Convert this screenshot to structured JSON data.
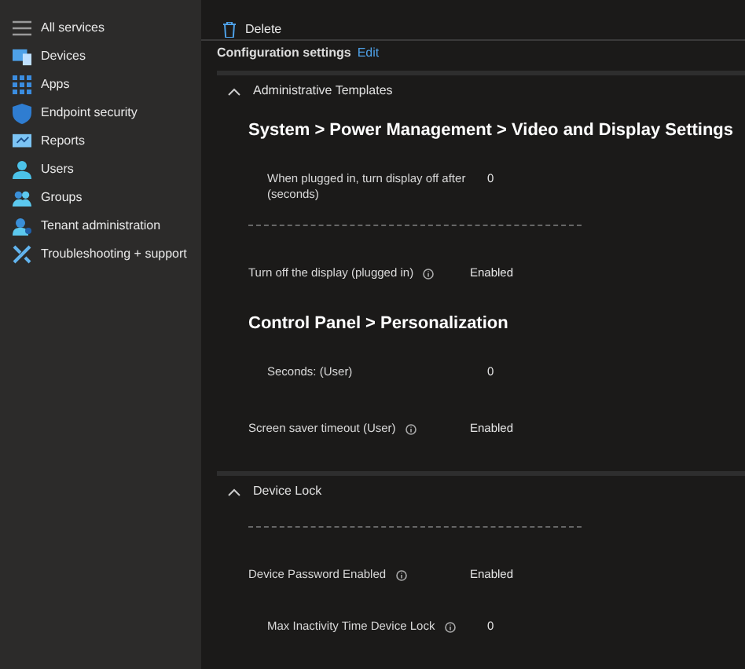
{
  "sidebar": {
    "items": [
      {
        "label": "All services"
      },
      {
        "label": "Devices"
      },
      {
        "label": "Apps"
      },
      {
        "label": "Endpoint security"
      },
      {
        "label": "Reports"
      },
      {
        "label": "Users"
      },
      {
        "label": "Groups"
      },
      {
        "label": "Tenant administration"
      },
      {
        "label": "Troubleshooting + support"
      }
    ]
  },
  "toolbar": {
    "buttons": [
      "Delete"
    ]
  },
  "config_header": {
    "title": "Configuration settings",
    "link": "Edit"
  },
  "sections": [
    {
      "title": "Administrative Templates",
      "expanded": true,
      "items": [
        {
          "kind": "heading",
          "text": "System > Power Management > Video and Display Settings"
        },
        {
          "kind": "sub_setting",
          "label": "When plugged in, turn display off after (seconds)",
          "value": "0",
          "info": false
        },
        {
          "kind": "divider"
        },
        {
          "kind": "setting",
          "label": "Turn off the display (plugged in)",
          "value": "Enabled",
          "info": true
        },
        {
          "kind": "heading",
          "text": "Control Panel > Personalization"
        },
        {
          "kind": "sub_setting",
          "label": "Seconds: (User)",
          "value": "0",
          "info": false
        },
        {
          "kind": "setting",
          "label": "Screen saver timeout (User)",
          "value": "Enabled",
          "info": true
        }
      ]
    },
    {
      "title": "Device Lock",
      "expanded": true,
      "items": [
        {
          "kind": "divider"
        },
        {
          "kind": "setting",
          "label": "Device Password Enabled",
          "value": "Enabled",
          "info": true
        },
        {
          "kind": "sub_setting",
          "label": "Max Inactivity Time Device Lock",
          "value": "0",
          "info": true
        }
      ]
    }
  ]
}
